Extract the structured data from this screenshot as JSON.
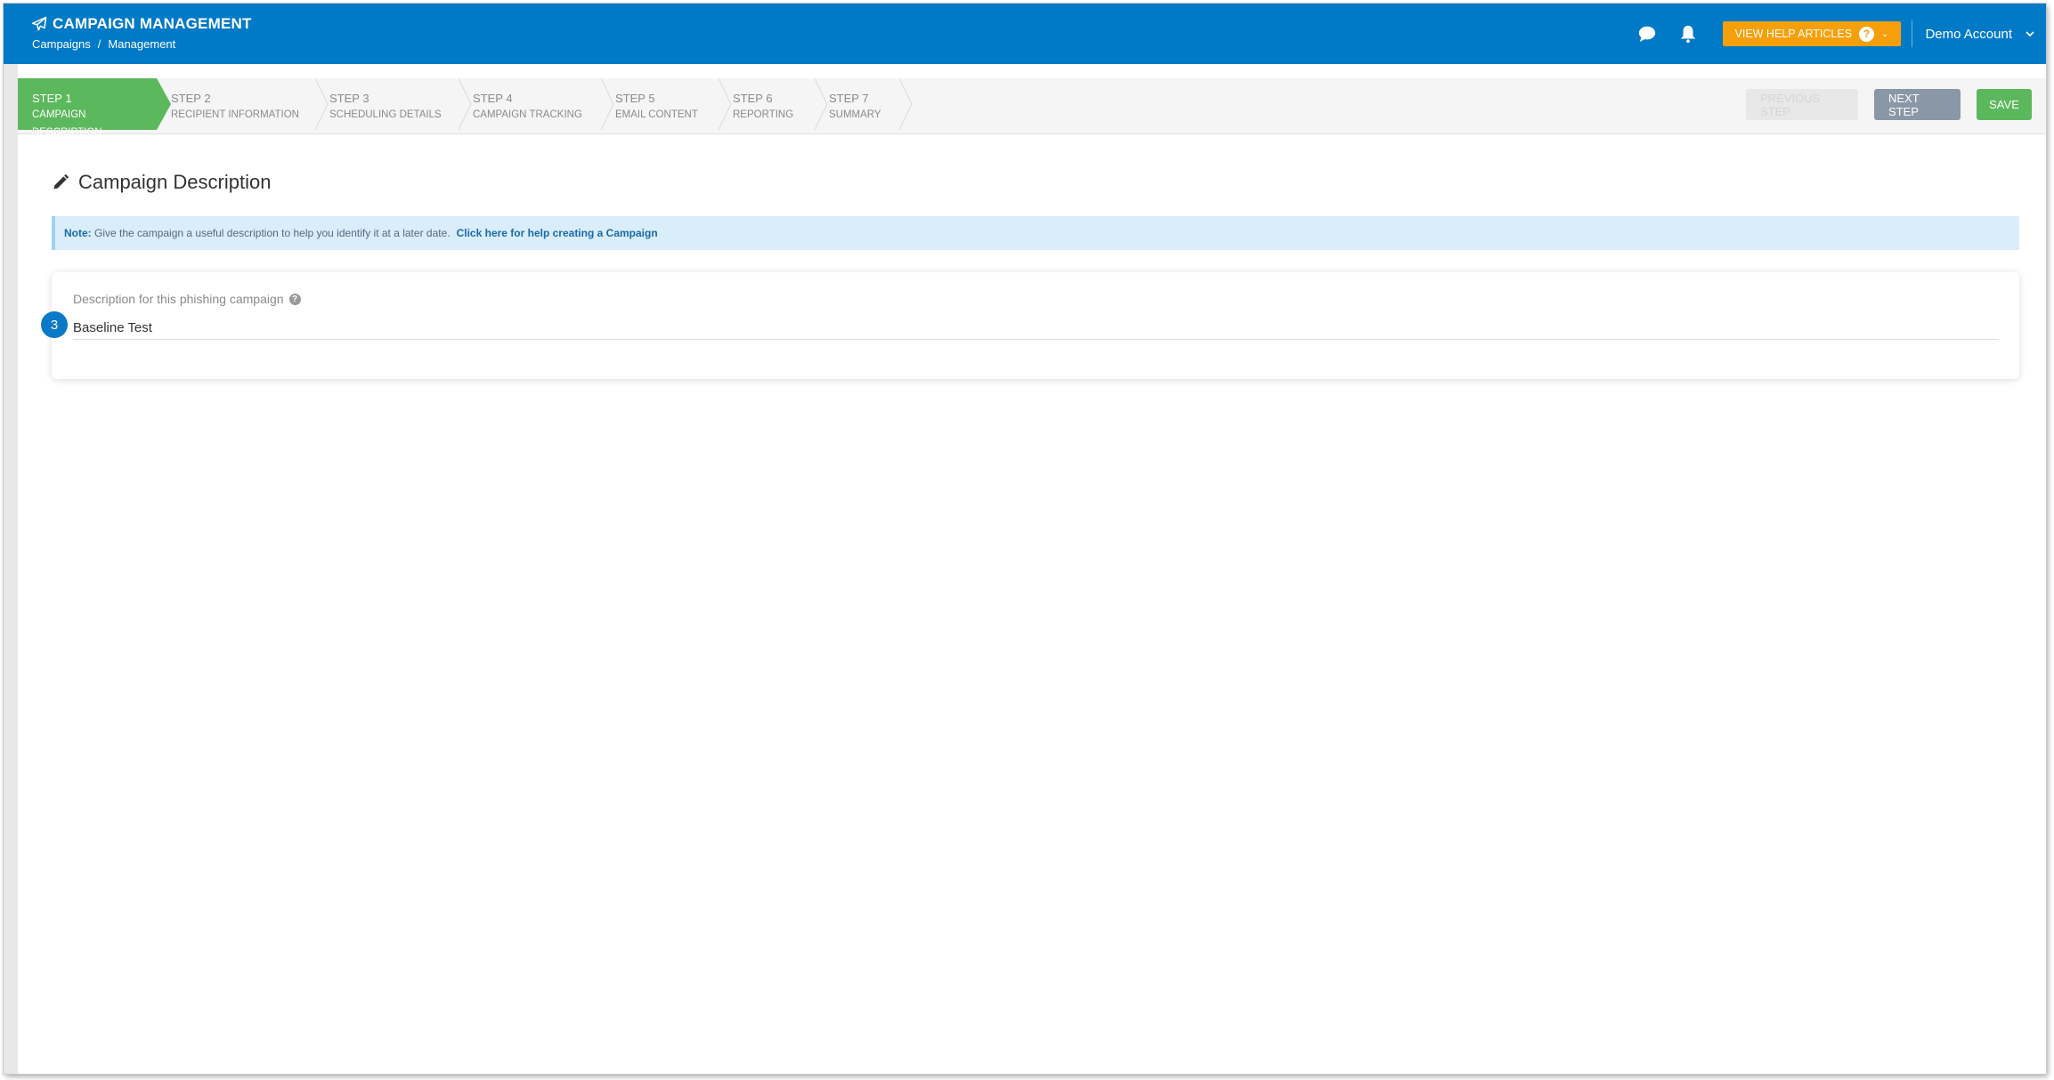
{
  "header": {
    "title": "CAMPAIGN MANAGEMENT",
    "breadcrumb": [
      "Campaigns",
      "/",
      "Management"
    ],
    "help_button": "VIEW HELP ARTICLES",
    "account": "Demo Account",
    "icons": [
      "paper-plane-icon",
      "chat-icon",
      "bell-icon",
      "question-icon",
      "chevron-down-icon"
    ]
  },
  "steps": [
    {
      "num": "STEP 1",
      "name": "CAMPAIGN DESCRIPTION",
      "active": true
    },
    {
      "num": "STEP 2",
      "name": "RECIPIENT INFORMATION",
      "active": false
    },
    {
      "num": "STEP 3",
      "name": "SCHEDULING DETAILS",
      "active": false
    },
    {
      "num": "STEP 4",
      "name": "CAMPAIGN TRACKING",
      "active": false
    },
    {
      "num": "STEP 5",
      "name": "EMAIL CONTENT",
      "active": false
    },
    {
      "num": "STEP 6",
      "name": "REPORTING",
      "active": false
    },
    {
      "num": "STEP 7",
      "name": "SUMMARY",
      "active": false
    }
  ],
  "actions": {
    "previous": "PREVIOUS STEP",
    "next": "NEXT STEP",
    "save": "SAVE"
  },
  "main": {
    "title": "Campaign Description",
    "note_label": "Note:",
    "note_text": "Give the campaign a useful description to help you identify it at a later date.",
    "note_link": "Click here for help creating a Campaign",
    "field_label": "Description for this phishing campaign",
    "field_value": "Baseline Test",
    "badge": "3"
  },
  "colors": {
    "header": "#0079c6",
    "active_step": "#5cb85c",
    "help_button": "#f5a00a",
    "next_button": "#8a97a6",
    "save_button": "#5cb85c"
  }
}
